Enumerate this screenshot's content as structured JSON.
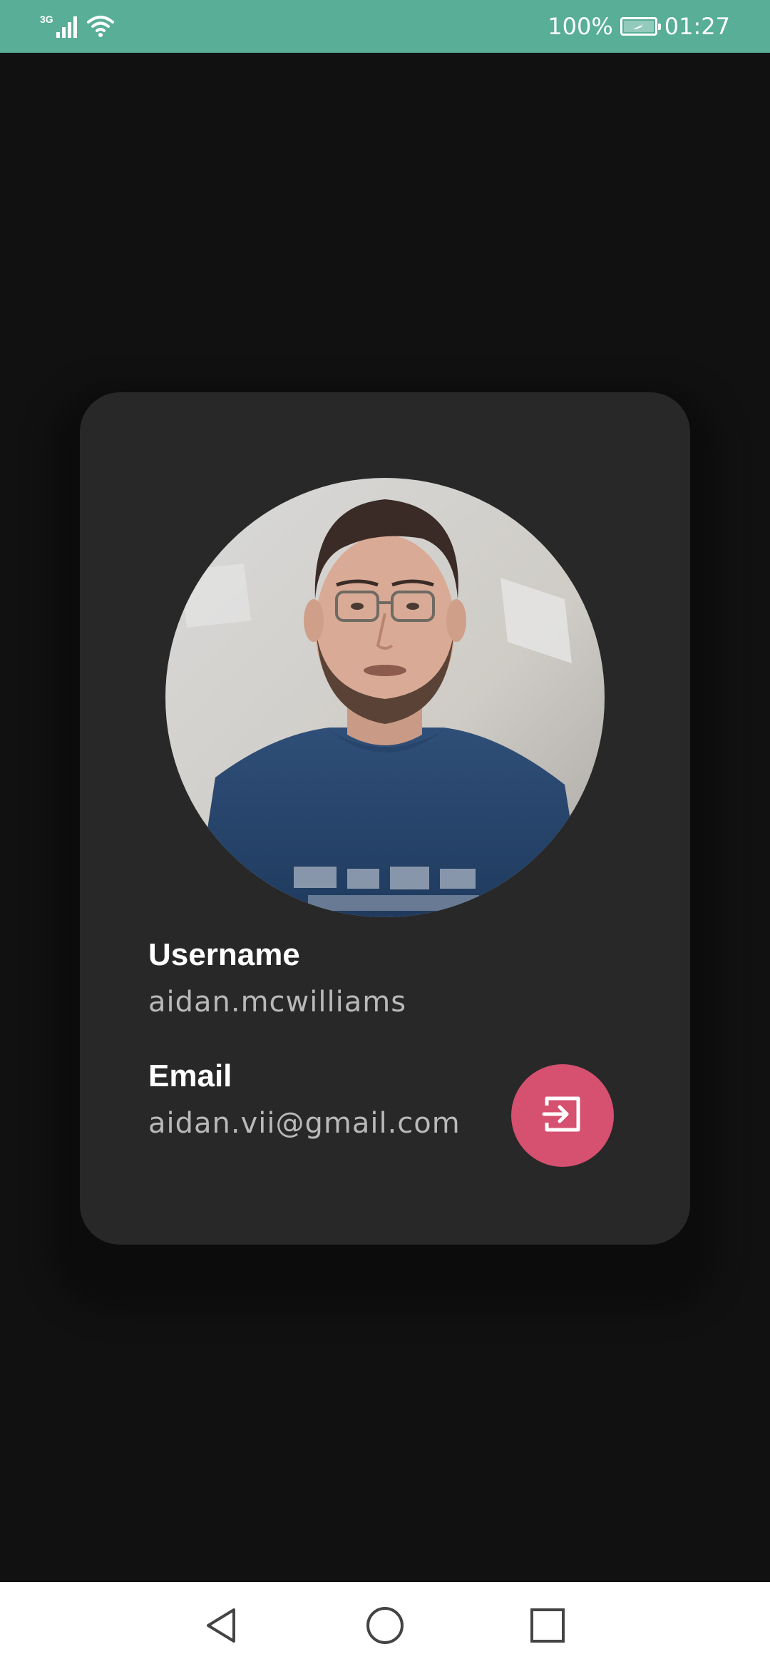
{
  "status_bar": {
    "network_type": "3G",
    "battery_percent": "100%",
    "time": "01:27",
    "background_color": "#58ae97",
    "icons": [
      "signal-icon",
      "wifi-icon",
      "battery-icon"
    ]
  },
  "profile_card": {
    "avatar_description": "user profile photo",
    "username_label": "Username",
    "username_value": "aidan.mcwilliams",
    "email_label": "Email",
    "email_value": "aidan.vii@gmail.com",
    "logout_icon": "exit-to-app-icon",
    "accent_color": "#d6506f",
    "card_color": "#282828"
  },
  "navigation_bar": {
    "buttons": [
      "back-icon",
      "home-icon",
      "recents-icon"
    ]
  }
}
